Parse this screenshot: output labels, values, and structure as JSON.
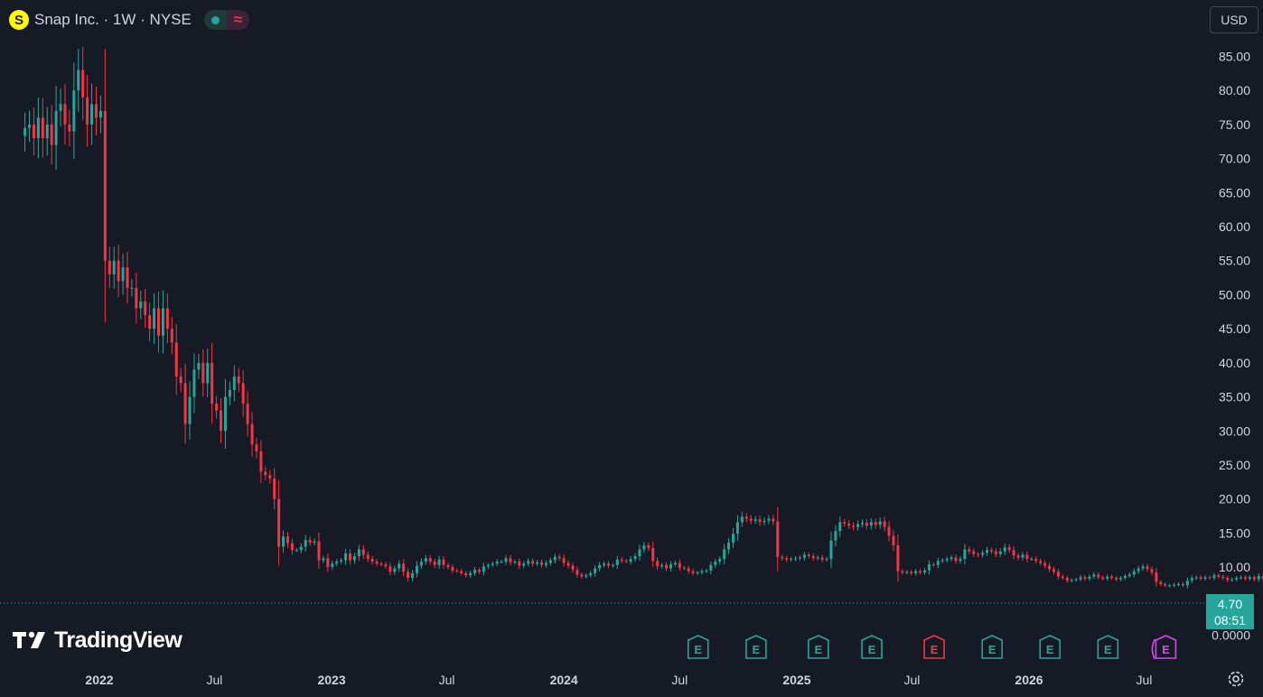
{
  "header": {
    "logo_letter": "S",
    "title": "Snap Inc. · 1W · NYSE",
    "status_icon": "market-status-dot",
    "wave_glyph": "≈"
  },
  "currency": "USD",
  "price_tag": {
    "price": "4.70",
    "countdown": "08:51"
  },
  "branding": {
    "name": "TradingView"
  },
  "colors": {
    "background": "#161a25",
    "up": "#26a69a",
    "down": "#f23645",
    "axis_text": "#d1d4dc",
    "earnings_up": "#26a69a",
    "earnings_down": "#f23645",
    "earnings_upcoming": "#e040fb"
  },
  "chart_data": {
    "type": "candlestick",
    "symbol": "Snap Inc.",
    "interval": "1W",
    "exchange": "NYSE",
    "ylim": [
      0,
      87
    ],
    "y_ticks": [
      "85.00",
      "80.00",
      "75.00",
      "70.00",
      "65.00",
      "60.00",
      "55.00",
      "50.00",
      "45.00",
      "40.00",
      "35.00",
      "30.00",
      "25.00",
      "20.00",
      "15.00",
      "10.00",
      "0.0000"
    ],
    "y_tick_values": [
      85,
      80,
      75,
      70,
      65,
      60,
      55,
      50,
      45,
      40,
      35,
      30,
      25,
      20,
      15,
      10,
      0
    ],
    "x_ticks": [
      {
        "label": "2022",
        "bold": true,
        "date": "2022-01-01"
      },
      {
        "label": "Jul",
        "bold": false,
        "date": "2022-07-01"
      },
      {
        "label": "2023",
        "bold": true,
        "date": "2023-01-01"
      },
      {
        "label": "Jul",
        "bold": false,
        "date": "2023-07-01"
      },
      {
        "label": "2024",
        "bold": true,
        "date": "2024-01-01"
      },
      {
        "label": "Jul",
        "bold": false,
        "date": "2024-07-01"
      },
      {
        "label": "2025",
        "bold": true,
        "date": "2025-01-01"
      },
      {
        "label": "Jul",
        "bold": false,
        "date": "2025-07-01"
      },
      {
        "label": "2026",
        "bold": true,
        "date": "2026-01-01"
      },
      {
        "label": "Jul",
        "bold": false,
        "date": "2026-07-01"
      }
    ],
    "first_week": "2021-09-06",
    "last_price": 4.7,
    "closes": [
      74.5,
      75,
      73,
      76,
      73,
      75,
      72,
      77,
      78,
      75,
      74,
      80,
      83,
      79,
      75,
      78,
      76,
      77,
      55,
      53,
      55,
      52,
      54,
      51,
      51,
      48,
      49,
      47,
      45,
      48,
      44,
      48,
      45,
      43,
      38,
      37,
      31,
      35,
      39,
      40,
      37,
      40,
      34,
      33,
      30,
      35,
      36,
      38,
      37,
      34,
      31,
      28,
      27,
      24,
      23.5,
      23,
      20,
      13,
      14.5,
      13.5,
      12.5,
      12.5,
      13,
      14,
      13.6,
      13.8,
      11,
      11.3,
      10,
      10.5,
      10.8,
      11,
      12,
      11,
      11.6,
      12.6,
      11.8,
      11.2,
      10.8,
      10.5,
      10.4,
      10.1,
      9.3,
      9.8,
      10.5,
      9.3,
      8.4,
      9.1,
      10.2,
      10.8,
      11.3,
      10.8,
      10.3,
      11.1,
      10.3,
      10,
      9.5,
      9.4,
      9.1,
      8.8,
      9.1,
      9.6,
      9.3,
      10.1,
      10.3,
      10.5,
      10.8,
      10.8,
      11.3,
      10.7,
      10.8,
      10.2,
      10.5,
      10.9,
      10.5,
      10.7,
      10.3,
      10.6,
      11,
      11.5,
      11.3,
      10.6,
      10.2,
      9.6,
      8.9,
      8.6,
      8.8,
      9.1,
      9.8,
      10.3,
      10.5,
      10.2,
      10.3,
      11.1,
      10.9,
      10.8,
      11.2,
      11.6,
      12.6,
      13.2,
      12.8,
      10.9,
      10.1,
      10.3,
      9.8,
      10.4,
      10.6,
      9.9,
      9.8,
      9.4,
      9.1,
      9.2,
      9.4,
      9.5,
      10.3,
      10.8,
      11.2,
      12.6,
      13.6,
      14.9,
      16.6,
      17.4,
      17.1,
      16.8,
      17,
      16.6,
      16.8,
      17.1,
      16.7,
      11.5,
      11.3,
      11.1,
      11.2,
      11.3,
      11.4,
      11.8,
      11.6,
      11.3,
      11.4,
      11.1,
      11.2,
      13.9,
      15.3,
      16.6,
      16.4,
      16.1,
      15.9,
      16.3,
      16.5,
      16.1,
      16.6,
      16.2,
      16.7,
      15.9,
      14.6,
      13.2,
      9.4,
      9.2,
      9.3,
      9.1,
      9.4,
      9.2,
      9.5,
      10.4,
      10.3,
      10.9,
      11,
      11.2,
      11.4,
      10.9,
      11.2,
      12.6,
      12.3,
      11.9,
      11.8,
      12.1,
      12.5,
      12.3,
      11.9,
      12.3,
      12.9,
      12.5,
      11.7,
      11.4,
      11.8,
      11.2,
      11.2,
      10.9,
      10.6,
      10.2,
      9.7,
      9.3,
      8.6,
      8.4,
      8,
      8.1,
      8.2,
      8.5,
      8.3,
      8.6,
      8.9,
      8.5,
      8.3,
      8.6,
      8.4,
      8.2,
      8.4,
      8.7,
      8.9,
      9.4,
      9.8,
      10.1,
      9.7,
      9.2,
      7.8,
      7.5,
      7.3,
      7.3,
      7.4,
      7.5,
      7.3,
      8,
      8.4,
      8.5,
      8.3,
      8.5,
      8.4,
      8.8,
      8.6,
      8.4,
      8.1,
      8.2,
      8.4,
      8.5,
      8.3,
      8.5,
      8.2,
      8.7,
      8.2,
      7.6,
      6.4,
      5.6,
      5.4,
      5.3,
      5.2,
      5.2,
      4.9,
      5.3,
      4.5,
      4.3,
      4.9,
      5.3,
      5.8,
      6.1,
      6,
      5.8,
      5.9,
      5.7,
      5.6,
      5.8,
      5.7,
      5.4,
      4.9,
      4.6,
      4.8,
      4.6,
      4.7,
      4.6,
      4.7
    ],
    "earnings": [
      {
        "date": "2024-07-30",
        "label": "E",
        "status": "up"
      },
      {
        "date": "2024-10-29",
        "label": "E",
        "status": "up"
      },
      {
        "date": "2025-02-04",
        "label": "E",
        "status": "up"
      },
      {
        "date": "2025-04-29",
        "label": "E",
        "status": "up"
      },
      {
        "date": "2025-08-05",
        "label": "E",
        "status": "down"
      },
      {
        "date": "2025-11-04",
        "label": "E",
        "status": "up"
      },
      {
        "date": "2026-02-03",
        "label": "E",
        "status": "up"
      },
      {
        "date": "2026-05-05",
        "label": "E",
        "status": "up"
      },
      {
        "date": "2026-08-04",
        "label": "E",
        "status": "upcoming"
      }
    ]
  }
}
